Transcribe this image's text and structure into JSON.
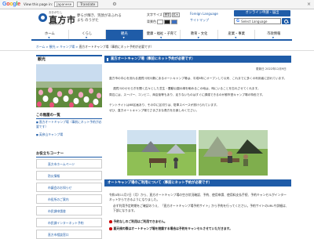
{
  "translate_bar": {
    "view_text": "View this page in:",
    "language": "Japanese",
    "translate_button": "Translate",
    "close": "×",
    "settings": "⚙"
  },
  "header": {
    "logo_small": "おおがたし",
    "logo_text": "直方市",
    "logo_sub": "NOGATA CITY",
    "tagline_1": "夢らが輝き、笑顔があふれる",
    "tagline_2": "まち のうがた",
    "text_size_label": "文字サイズ",
    "text_size_standard": "標準",
    "text_size_large": "拡大",
    "bg_color_label": "背景色",
    "link_1": "Foreign Language",
    "link_2": "サイトマップ",
    "online_button": "オンライン申請・届出",
    "search_placeholder": "Select Language",
    "search_g": "G"
  },
  "gnav": [
    {
      "label": "ホーム"
    },
    {
      "label": "くらし"
    },
    {
      "label": "観光"
    },
    {
      "label": "健康・福祉・子育て"
    },
    {
      "label": "教育・文化"
    },
    {
      "label": "産業・事業"
    },
    {
      "label": "市政情報"
    }
  ],
  "breadcrumb": {
    "items": [
      "ホーム",
      "観光",
      "キャンプ場",
      "直方オートキャンプ場（事前にネット予約が必要です）"
    ],
    "separator": ">"
  },
  "sidebar": {
    "section_title": "観光",
    "category_title": "この階層の一覧",
    "links": [
      "直方オートキャンプ場（事前にネット予約が必要です）",
      "英彦山キャンプ場"
    ],
    "useful_title": "お役立ちコーナー",
    "useful_links": [
      "直方市ホームページ",
      "防災情報",
      "市議会のお知らせ",
      "市役所のご案内",
      "市民課申請書",
      "市民課インターネット予約",
      "直方市相談窓口"
    ]
  },
  "main": {
    "title": "直方オートキャンプ場（事前にネット予約が必要です）",
    "updated": "更新日 2022年12月9日",
    "paragraphs": [
      "直方市の中心を流れる遠賀川河川敷にあるオートキャンプ場は、平成8年にオープンして以来、これまでに多くの利用者に訪れています。",
      "遠賀川のせせらぎを聞く広々とした芝生・震動公園の緑を眺めるこの地は、時にいることを忘れさせてくれます。",
      "周辺には、スーパー、コンビニ、商店街等もあり、足りないものはすぐに調達できるのが都市型キャンプ場の特色です。",
      "テントサイトは68区画あり、その中に区切りは、駐車スペースが設けられています。",
      "ぜひ、直方オートキャンプ場でさまざまな貴方をお楽しみください。"
    ],
    "section_title": "オートキャンプ場のご利用について（事前にネット予約が必要です）",
    "notes": [
      "令和4年11月7日（月）から、直方オートキャンプ場の空き状況確認、予約、使用申請、使用料支払手続、予約キャンセルがインターネットからできるようになりました。",
      "必ず利用予定時期をご確認のうえ、「直方オートキャンプ場予約サイト」から予約を行ってください。予約サイトのURLや詳細は、下部になります。"
    ],
    "bullet_1": "予約なしのご利用はご利用できません。",
    "bullet_2": "悪天候の際はオートキャンプ場を閉鎖する場合は予約をキャンセルさせていただきます。"
  },
  "colors": {
    "brand": "#1f5ca8",
    "alert": "#cc0000"
  }
}
